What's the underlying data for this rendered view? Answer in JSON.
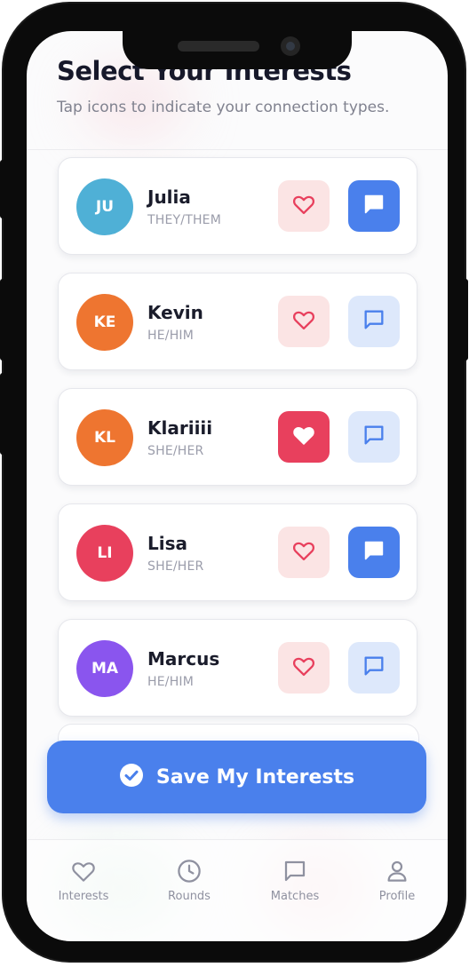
{
  "header": {
    "title": "Select Your Interests",
    "subtitle": "Tap icons to indicate your connection types."
  },
  "people": [
    {
      "initials": "JU",
      "name": "Julia",
      "pronouns": "THEY/THEM",
      "avatar_color": "#4fb0d6",
      "heart_selected": false,
      "chat_selected": true
    },
    {
      "initials": "KE",
      "name": "Kevin",
      "pronouns": "HE/HIM",
      "avatar_color": "#ee7530",
      "heart_selected": false,
      "chat_selected": false
    },
    {
      "initials": "KL",
      "name": "Klariiii",
      "pronouns": "SHE/HER",
      "avatar_color": "#ee7530",
      "heart_selected": true,
      "chat_selected": false
    },
    {
      "initials": "LI",
      "name": "Lisa",
      "pronouns": "SHE/HER",
      "avatar_color": "#e8405d",
      "heart_selected": false,
      "chat_selected": true
    },
    {
      "initials": "MA",
      "name": "Marcus",
      "pronouns": "HE/HIM",
      "avatar_color": "#8a55ee",
      "heart_selected": false,
      "chat_selected": false
    }
  ],
  "save_button": {
    "label": "Save My Interests",
    "icon": "check-circle-icon"
  },
  "tabs": [
    {
      "label": "Interests",
      "icon": "heart-icon"
    },
    {
      "label": "Rounds",
      "icon": "clock-icon"
    },
    {
      "label": "Matches",
      "icon": "chat-icon"
    },
    {
      "label": "Profile",
      "icon": "user-icon"
    }
  ],
  "colors": {
    "accent": "#4a80ec",
    "heart_active": "#e8405d",
    "heart_inactive_bg": "#fbe4e4",
    "chat_inactive_bg": "#dde8fb"
  }
}
